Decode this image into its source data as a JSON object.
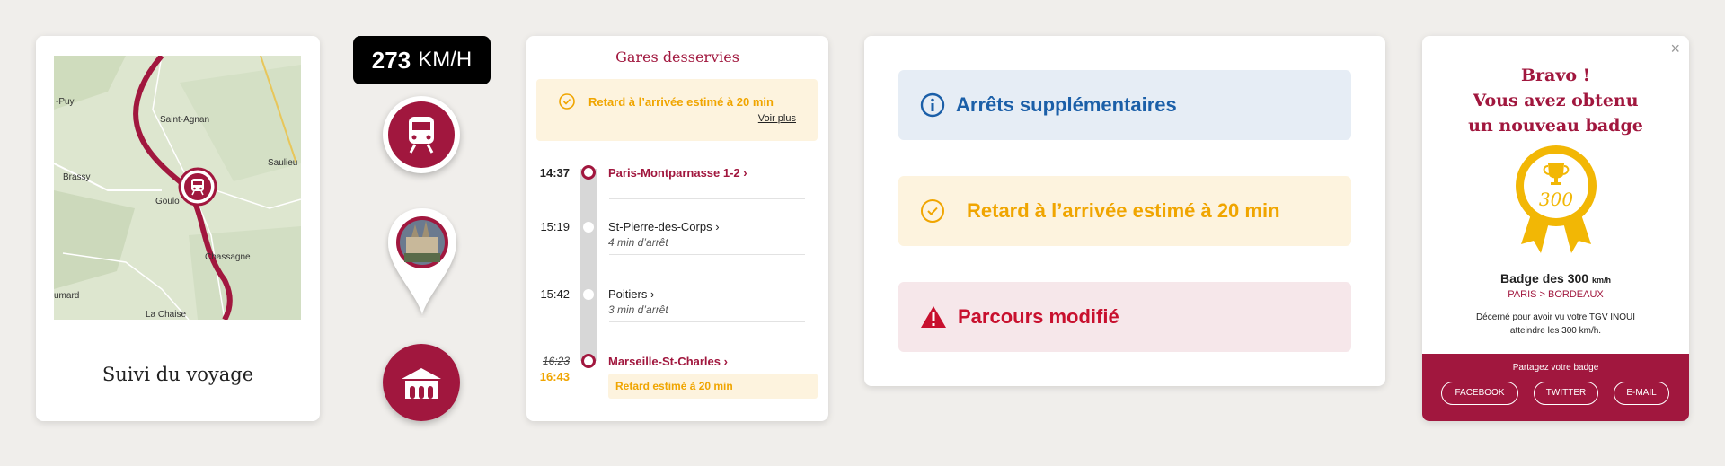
{
  "map_card": {
    "title": "Suivi du voyage",
    "towns": [
      "-Puy",
      "Saint-Agnan",
      "Saulieu",
      "Brassy",
      "Goulo",
      "Chassagne",
      "umard",
      "La Chaise"
    ]
  },
  "speed": {
    "value": "273",
    "unit": "KM/H"
  },
  "icons": {
    "train": "train-icon",
    "station": "station-icon",
    "location_pin": "map-pin-photo-icon"
  },
  "stops_card": {
    "title": "Gares desservies",
    "delay_banner": {
      "text": "Retard à l’arrivée estimé à 20 min",
      "link": "Voir plus"
    },
    "stops": [
      {
        "time": "14:37",
        "name": "Paris-Montparnasse 1-2",
        "note": ""
      },
      {
        "time": "15:19",
        "name": "St-Pierre-des-Corps",
        "note": "4 min d’arrêt"
      },
      {
        "time": "15:42",
        "name": "Poitiers",
        "note": "3 min d’arrêt"
      }
    ],
    "final_stop": {
      "scheduled_time": "16:23",
      "estimated_time": "16:43",
      "name": "Marseille-St-Charles",
      "delay_note": "Retard estimé à 20 min"
    }
  },
  "alerts": {
    "info": "Arrêts supplémentaires",
    "delay": "Retard à l’arrivée estimé à 20 min",
    "route": "Parcours modifié"
  },
  "badge_card": {
    "close": "×",
    "heading": [
      "Bravo !",
      "Vous avez obtenu",
      "un nouveau badge"
    ],
    "medal_number": "300",
    "badge_name": "Badge des 300",
    "badge_unit": "km/h",
    "route": "PARIS > BORDEAUX",
    "description": "Décerné pour avoir vu votre TGV INOUI atteindre les 300 km/h.",
    "share_label": "Partagez votre badge",
    "share_buttons": [
      "FACEBOOK",
      "TWITTER",
      "E-MAIL"
    ]
  },
  "colors": {
    "brand": "#a1173e",
    "warning": "#f0a500",
    "info": "#1b5fa8",
    "danger": "#c8102e"
  }
}
